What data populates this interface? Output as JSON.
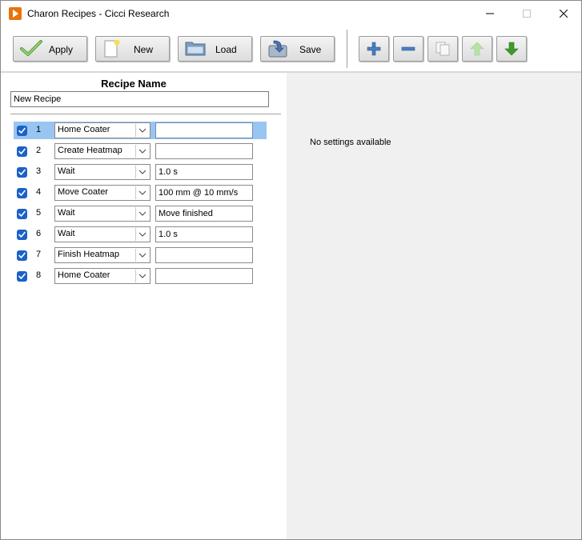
{
  "window": {
    "title": "Charon Recipes - Cicci Research",
    "app_icon": "play-icon",
    "controls": [
      "minimize-icon",
      "maximize-icon",
      "close-icon"
    ]
  },
  "toolbar": {
    "apply_label": "Apply",
    "new_label": "New",
    "load_label": "Load",
    "save_label": "Save",
    "step_actions": [
      "plus-icon",
      "minus-icon",
      "copy-icon",
      "arrow-up-icon",
      "arrow-down-icon"
    ]
  },
  "recipe": {
    "name_label": "Recipe Name",
    "name_value": "New Recipe",
    "steps": [
      {
        "num": "1",
        "checked": true,
        "action": "Home Coater",
        "param": "",
        "selected": true
      },
      {
        "num": "2",
        "checked": true,
        "action": "Create Heatmap",
        "param": ""
      },
      {
        "num": "3",
        "checked": true,
        "action": "Wait",
        "param": "1.0 s"
      },
      {
        "num": "4",
        "checked": true,
        "action": "Move Coater",
        "param": "100 mm @ 10 mm/s"
      },
      {
        "num": "5",
        "checked": true,
        "action": "Wait",
        "param": "Move finished"
      },
      {
        "num": "6",
        "checked": true,
        "action": "Wait",
        "param": "1.0 s"
      },
      {
        "num": "7",
        "checked": true,
        "action": "Finish Heatmap",
        "param": ""
      },
      {
        "num": "8",
        "checked": true,
        "action": "Home Coater",
        "param": ""
      }
    ]
  },
  "settings": {
    "empty_text": "No settings available"
  },
  "colors": {
    "accent": "#1a62c7",
    "selection": "#99c5f2",
    "app_icon": "#e8740c"
  }
}
